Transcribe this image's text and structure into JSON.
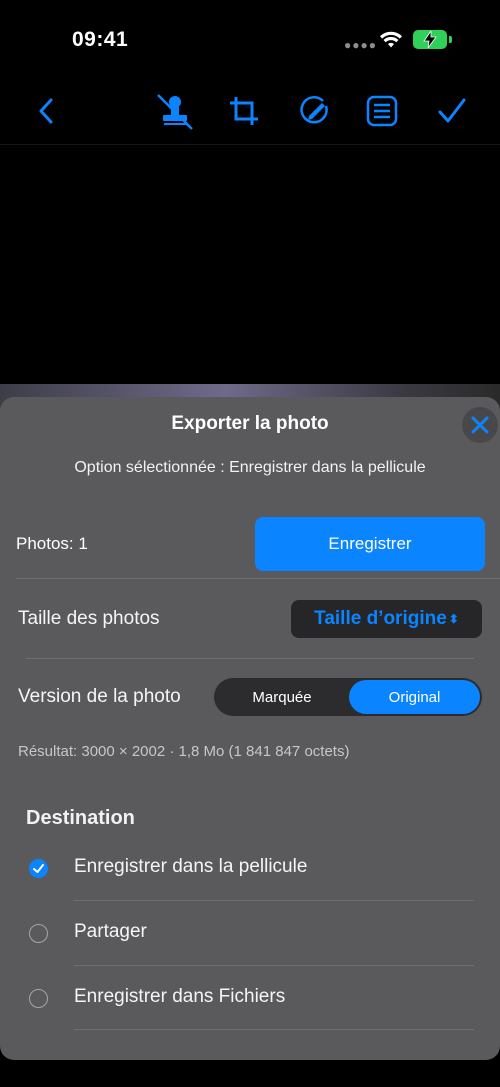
{
  "status_bar": {
    "time": "09:41"
  },
  "toolbar": {
    "icons": [
      "chevron-left-icon",
      "stamp-off-icon",
      "crop-icon",
      "markup-icon",
      "list-icon",
      "checkmark-icon"
    ]
  },
  "sheet": {
    "title": "Exporter la photo",
    "subtitle": "Option sélectionnée : Enregistrer dans la pellicule",
    "photos_count": "Photos: 1",
    "save_button": "Enregistrer",
    "size_label": "Taille des photos",
    "size_value": "Taille d’origine",
    "version_label": "Version de la photo",
    "version_options": [
      "Marquée",
      "Original"
    ],
    "version_selected": "Original",
    "result": "Résultat: 3000 × 2002 · 1,8 Mo (1 841 847 octets)",
    "destination_title": "Destination",
    "destinations": [
      {
        "label": "Enregistrer dans la pellicule",
        "selected": true
      },
      {
        "label": "Partager",
        "selected": false
      },
      {
        "label": "Enregistrer dans Fichiers",
        "selected": false
      }
    ]
  },
  "colors": {
    "accent": "#0a84ff",
    "battery": "#30d158",
    "sheet": "#5a5a5c"
  }
}
